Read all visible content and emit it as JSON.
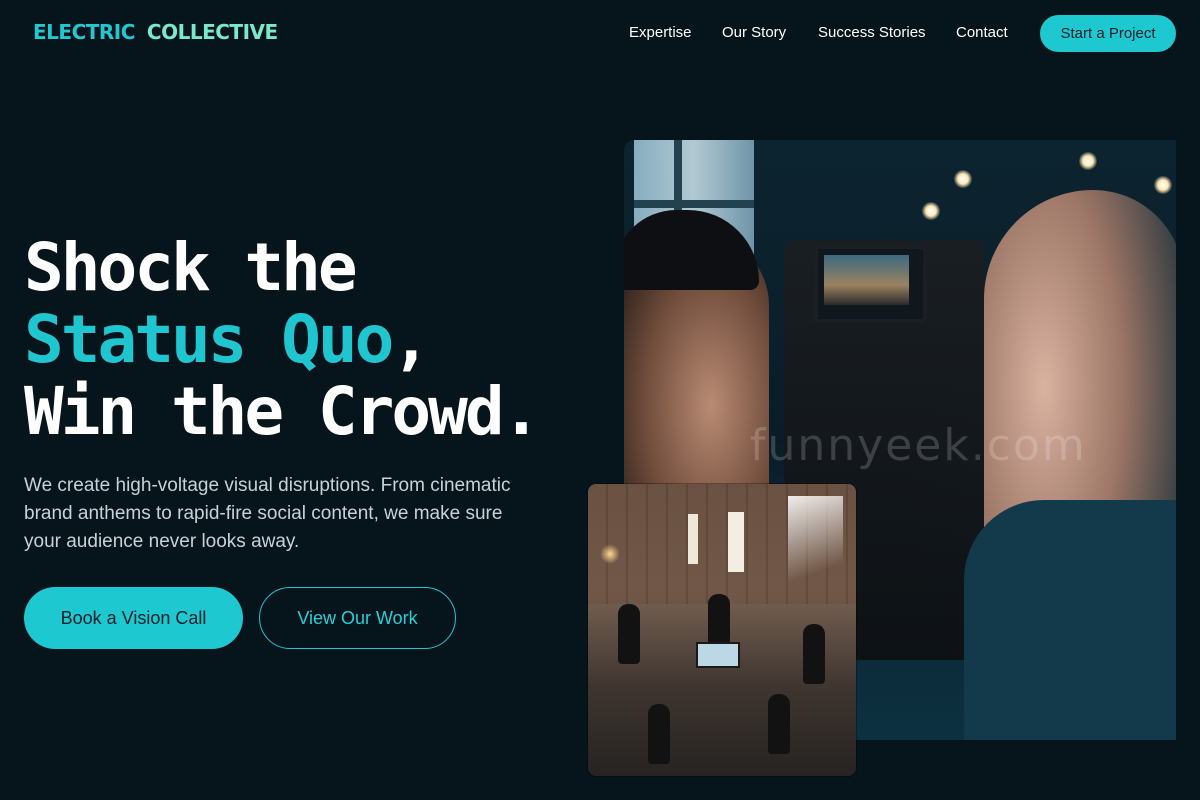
{
  "brand": {
    "word1": "ELECTRIC",
    "word2": "COLLECTIVE",
    "color_word1": "#23c7cf",
    "color_word2": "#79e8cc"
  },
  "nav": {
    "links": [
      "Expertise",
      "Our Story",
      "Success Stories",
      "Contact"
    ],
    "cta": "Start a Project"
  },
  "hero": {
    "headline_line1": "Shock the",
    "headline_accent": "Status Quo",
    "headline_comma": ",",
    "headline_line3": "Win the Crowd.",
    "subtext": "We create high-voltage visual disruptions. From cinematic brand anthems to rapid-fire social content, we make sure your audience never looks away.",
    "primary_button": "Book a Vision Call",
    "secondary_button": "View Our Work"
  },
  "images": {
    "main_alt": "Camera operators filming with a rig",
    "studio_alt": "Film crew working in a warehouse studio",
    "watermark": "funnyeek.com"
  },
  "colors": {
    "background": "#06141b",
    "accent": "#1dc8d1"
  }
}
